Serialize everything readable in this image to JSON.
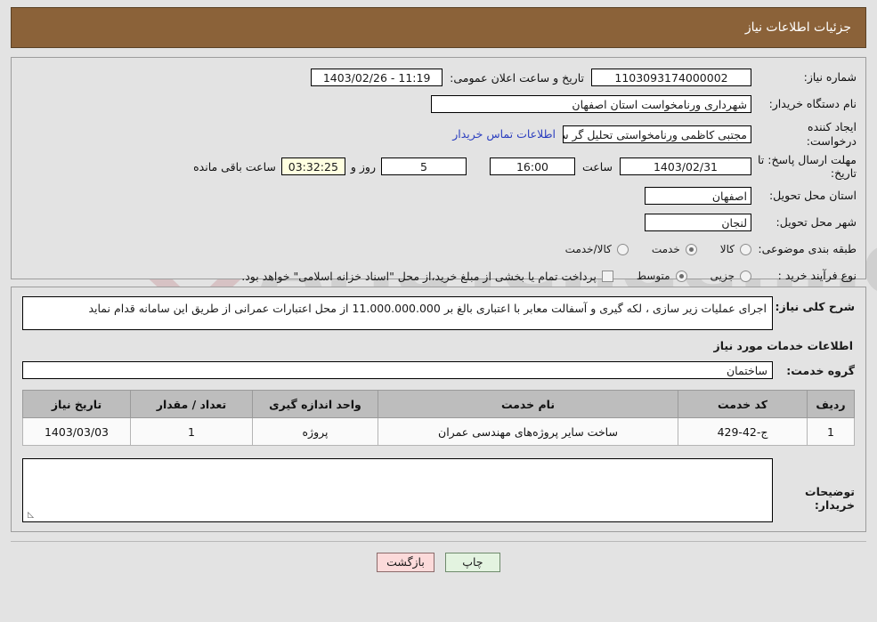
{
  "header": {
    "title": "جزئیات اطلاعات نیاز"
  },
  "form": {
    "need_number_label": "شماره نیاز:",
    "need_number_value": "1103093174000002",
    "public_announce_label": "تاریخ و ساعت اعلان عمومی:",
    "public_announce_value": "11:19 - 1403/02/26",
    "buyer_org_label": "نام دستگاه خریدار:",
    "buyer_org_value": "شهرداری ورنامخواست استان اصفهان",
    "creator_label": "ایجاد کننده درخواست:",
    "creator_value": "مجتبی کاظمی ورنامخواستی تحلیل گر سیستم  شهرداری ورنامخواست استان",
    "contact_link": "اطلاعات تماس خریدار",
    "deadline_label": "مهلت ارسال پاسخ: تا تاریخ:",
    "deadline_date": "1403/02/31",
    "hour_label": "ساعت",
    "hour_value": "16:00",
    "days_value": "5",
    "days_label": "روز و",
    "countdown_value": "03:32:25",
    "remaining_label": "ساعت باقی مانده",
    "province_label": "استان محل تحویل:",
    "province_value": "اصفهان",
    "city_label": "شهر محل تحویل:",
    "city_value": "لنجان",
    "category_label": "طبقه بندی موضوعی:",
    "category_options": [
      {
        "label": "کالا",
        "selected": false
      },
      {
        "label": "خدمت",
        "selected": true
      },
      {
        "label": "کالا/خدمت",
        "selected": false
      }
    ],
    "purchase_type_label": "نوع فرآیند خرید :",
    "purchase_type_options": [
      {
        "label": "جزیی",
        "selected": false
      },
      {
        "label": "متوسط",
        "selected": true
      }
    ],
    "treasury_checkbox_checked": false,
    "treasury_checkbox_label": "پرداخت تمام یا بخشی از مبلغ خرید،از محل \"اسناد خزانه اسلامی\" خواهد بود."
  },
  "details": {
    "description_label": "شرح کلی نیاز:",
    "description_value": "اجرای عملیات زیر سازی ، لکه گیری و آسفالت معابر با اعتباری بالغ بر 11.000.000.000 از محل اعتبارات عمرانی از طریق این سامانه قدام نماید",
    "section_title": "اطلاعات خدمات مورد نیاز",
    "service_group_label": "گروه خدمت:",
    "service_group_value": "ساختمان",
    "table": {
      "columns": [
        "ردیف",
        "کد خدمت",
        "نام خدمت",
        "واحد اندازه گیری",
        "تعداد / مقدار",
        "تاریخ نیاز"
      ],
      "rows": [
        {
          "row_no": "1",
          "service_code": "ج-42-429",
          "service_name": "ساخت سایر پروژه‌های مهندسی عمران",
          "unit": "پروژه",
          "quantity": "1",
          "need_date": "1403/03/03"
        }
      ]
    },
    "buyer_notes_label": "توضیحات خریدار:",
    "buyer_notes_value": ""
  },
  "buttons": {
    "back": "بازگشت",
    "print": "چاپ"
  },
  "watermark": {
    "brand_small": "AriaTender.net",
    "brand_big": "AriaTender.net"
  },
  "colors": {
    "header_bg": "#8b6239",
    "link": "#2c3fbf",
    "back_btn": "#fcdada",
    "print_btn": "#e3f3e0",
    "table_header": "#bdbdbd",
    "page_bg": "#e3e3e3"
  }
}
